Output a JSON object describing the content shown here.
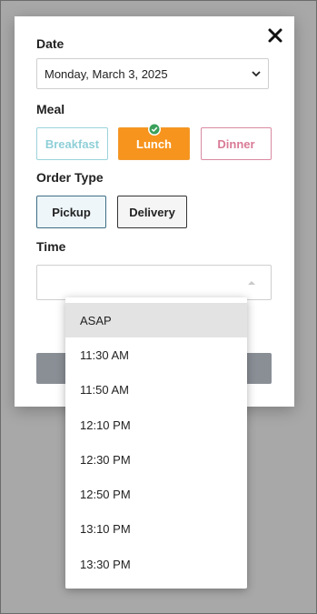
{
  "form": {
    "date_label": "Date",
    "date_value": "Monday, March 3, 2025",
    "meal_label": "Meal",
    "meals": [
      "Breakfast",
      "Lunch",
      "Dinner"
    ],
    "selected_meal": "Lunch",
    "order_type_label": "Order Type",
    "order_types": [
      "Pickup",
      "Delivery"
    ],
    "selected_order_type": "Pickup",
    "time_label": "Time",
    "time_value": ""
  },
  "time_options": [
    "ASAP",
    "11:30 AM",
    "11:50 AM",
    "12:10 PM",
    "12:30 PM",
    "12:50 PM",
    "13:10 PM",
    "13:30 PM"
  ],
  "highlighted_time_option": "ASAP",
  "colors": {
    "lunch_active": "#f7941d",
    "breakfast": "#8fcfd8",
    "dinner": "#d97a95",
    "submit": "#8a8f96"
  },
  "icons": [
    "close-icon",
    "chevron-down-icon",
    "check-circle-icon",
    "caret-up-icon"
  ]
}
